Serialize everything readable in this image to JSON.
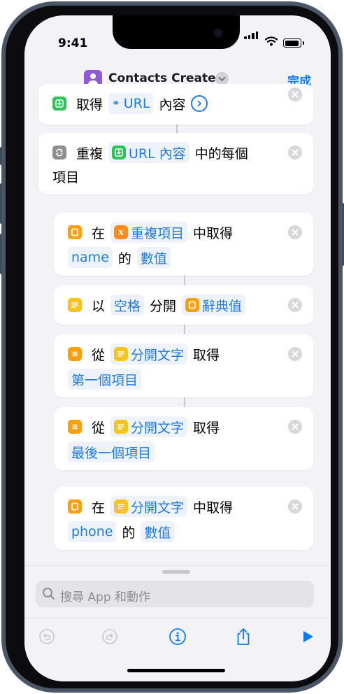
{
  "status": {
    "time": "9:41"
  },
  "header": {
    "app_name": "Contacts Create",
    "done_label": "完成"
  },
  "actions": [
    {
      "lines": [
        [
          "取得",
          "URL",
          "內容"
        ]
      ]
    },
    {
      "lines": [
        [
          "重複",
          "URL 內容",
          "中的每個"
        ],
        [
          "項目"
        ]
      ]
    },
    {
      "lines": [
        [
          "在",
          "重複項目",
          "中取得"
        ],
        [
          "name",
          "的",
          "數值"
        ]
      ]
    },
    {
      "lines": [
        [
          "以",
          "空格",
          "分開",
          "辭典值"
        ]
      ]
    },
    {
      "lines": [
        [
          "從",
          "分開文字",
          "取得"
        ],
        [
          "第一個項目"
        ]
      ]
    },
    {
      "lines": [
        [
          "從",
          "分開文字",
          "取得"
        ],
        [
          "最後一個項目"
        ]
      ]
    },
    {
      "lines": [
        [
          "在",
          "分開文字",
          "中取得"
        ],
        [
          "phone",
          "的",
          "數值"
        ]
      ]
    }
  ],
  "search": {
    "placeholder": "搜尋 App 和動作"
  },
  "icons": {
    "app": "contacts-person-icon",
    "get_contents": "download-box-icon",
    "repeat": "repeat-arrows-icon",
    "dictionary": "dictionary-icon",
    "variable": "variable-x-icon",
    "text": "text-lines-icon",
    "list": "list-icon",
    "remove": "close-circle-icon",
    "toolbar": [
      "undo-icon",
      "redo-icon",
      "info-icon",
      "share-icon",
      "play-icon"
    ]
  },
  "colors": {
    "accent": "#0a7aff",
    "token_bg": "#eef3fb",
    "green_icon": "#2fc25b",
    "orange_icon": "#ff9f0a",
    "yellow_icon": "#f7c31e",
    "app_icon": "#8e5bd6"
  }
}
